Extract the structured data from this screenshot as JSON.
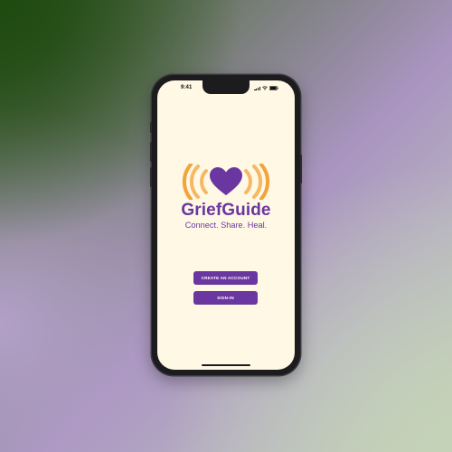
{
  "status_bar": {
    "time": "9:41",
    "icons": [
      "signal-icon",
      "wifi-icon",
      "battery-icon"
    ]
  },
  "logo": {
    "icon": "heart-broadcast-icon",
    "brand_name": "GriefGuide",
    "tagline": "Connect. Share. Heal."
  },
  "actions": {
    "create_account_label": "CREATE AN ACCOUNT",
    "sign_in_label": "SIGN-IN"
  },
  "colors": {
    "brand_purple": "#6a36a0",
    "accent_orange": "#f2a33a",
    "screen_background": "#fff8e4"
  }
}
